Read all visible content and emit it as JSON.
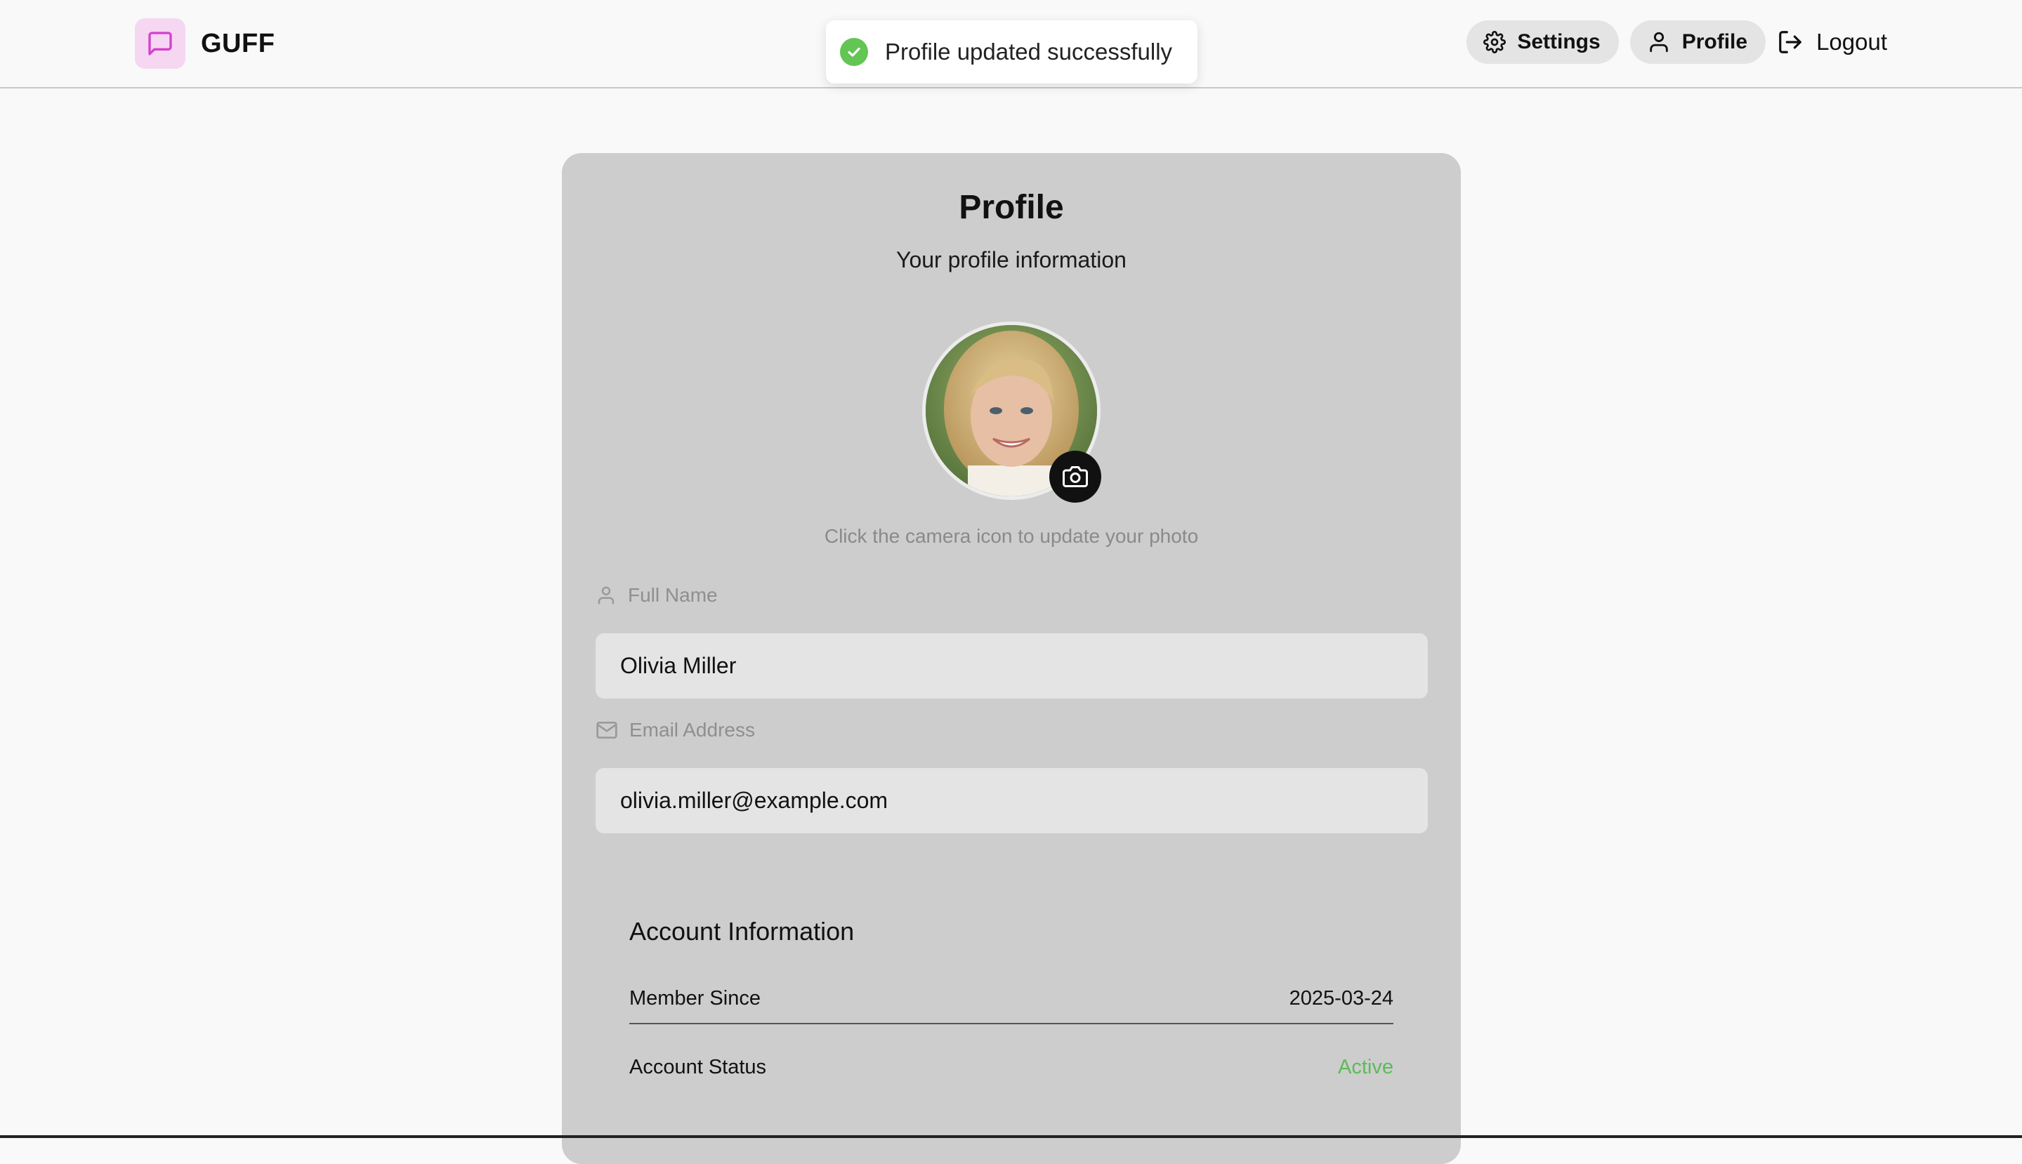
{
  "navbar": {
    "brand_name": "GUFF",
    "settings_label": "Settings",
    "profile_label": "Profile",
    "logout_label": "Logout"
  },
  "toast": {
    "message": "Profile updated successfully",
    "color": "#62c554"
  },
  "profile": {
    "title": "Profile",
    "subtitle": "Your profile information",
    "avatar_hint": "Click the camera icon to update your photo",
    "full_name_label": "Full Name",
    "full_name_value": "Olivia Miller",
    "email_label": "Email Address",
    "email_value": "olivia.miller@example.com"
  },
  "account": {
    "title": "Account Information",
    "member_since_label": "Member Since",
    "member_since_value": "2025-03-24",
    "status_label": "Account Status",
    "status_value": "Active",
    "status_color": "#5cbb58"
  },
  "icons": {
    "brand": "message-square-icon",
    "settings": "gear-icon",
    "profile": "user-icon",
    "logout": "logout-icon",
    "toast": "check-circle-icon",
    "camera": "camera-icon",
    "name_field": "user-icon",
    "email_field": "mail-icon"
  }
}
